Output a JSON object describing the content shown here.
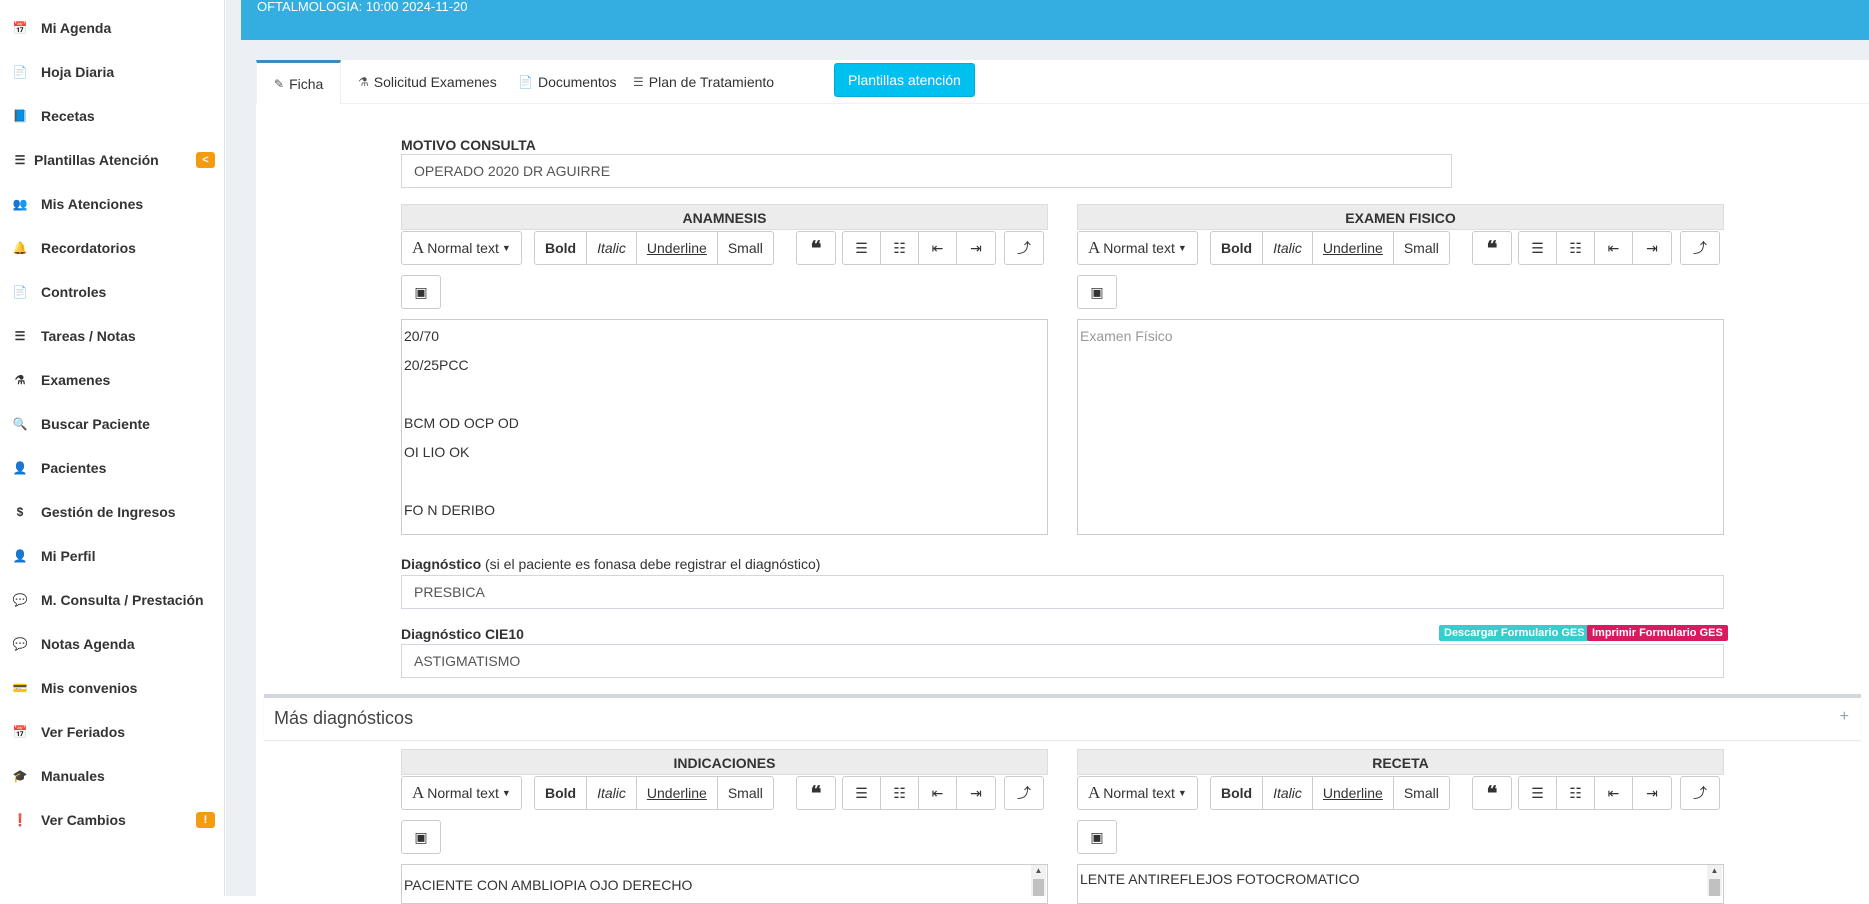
{
  "sidebar": {
    "items": [
      {
        "label": "Mi Agenda",
        "icon": "📅"
      },
      {
        "label": "Hoja Diaria",
        "icon": "📄"
      },
      {
        "label": "Recetas",
        "icon": "📘"
      },
      {
        "label": "Plantillas Atención",
        "icon": "☰",
        "badge": "<"
      },
      {
        "label": "Mis Atenciones",
        "icon": "👥"
      },
      {
        "label": "Recordatorios",
        "icon": "🔔"
      },
      {
        "label": "Controles",
        "icon": "📄"
      },
      {
        "label": "Tareas / Notas",
        "icon": "☰"
      },
      {
        "label": "Examenes",
        "icon": "⚗"
      },
      {
        "label": "Buscar Paciente",
        "icon": "🔍"
      },
      {
        "label": "Pacientes",
        "icon": "👤"
      },
      {
        "label": "Gestión de Ingresos",
        "icon": "$"
      },
      {
        "label": "Mi Perfil",
        "icon": "👤"
      },
      {
        "label": "M. Consulta / Prestación",
        "icon": "💬"
      },
      {
        "label": "Notas Agenda",
        "icon": "💬"
      },
      {
        "label": "Mis convenios",
        "icon": "💳"
      },
      {
        "label": "Ver Feriados",
        "icon": "📅"
      },
      {
        "label": "Manuales",
        "icon": "🎓"
      },
      {
        "label": "Ver Cambios",
        "icon": "❗",
        "badge": "!"
      }
    ]
  },
  "header": {
    "title": "OFTALMOLOGIA: 10:00 2024-11-20"
  },
  "tabs": [
    {
      "label": "Ficha",
      "icon": "✎"
    },
    {
      "label": "Solicitud Examenes",
      "icon": "⚗"
    },
    {
      "label": "Documentos",
      "icon": "📄"
    },
    {
      "label": "Plan de Tratamiento",
      "icon": "☰"
    }
  ],
  "plantillas_button": "Plantillas atención",
  "motivo": {
    "label": "MOTIVO CONSULTA",
    "value": "OPERADO 2020 DR AGUIRRE"
  },
  "toolbar": {
    "normal_text": "Normal text",
    "bold": "Bold",
    "italic": "Italic",
    "underline": "Underline",
    "small": "Small"
  },
  "anamnesis": {
    "title": "ANAMNESIS",
    "lines": [
      "20/70",
      "20/25PCC",
      "",
      "BCM OD OCP OD",
      "OI LIO OK",
      "",
      "FO N DERIBO"
    ]
  },
  "examen_fisico": {
    "title": "EXAMEN FISICO",
    "placeholder": "Examen Físico"
  },
  "diagnostico": {
    "label": "Diagnóstico",
    "sublabel": "(si el paciente es fonasa debe registrar el diagnóstico)",
    "value": "PRESBICA"
  },
  "cie10": {
    "label": "Diagnóstico CIE10",
    "value": "ASTIGMATISMO",
    "download_ges": "Descargar Formulario GES",
    "print_ges": "Imprimir Formulario GES"
  },
  "mas_diagnosticos": {
    "title": "Más diagnósticos",
    "toggle": "+"
  },
  "indicaciones": {
    "title": "INDICACIONES",
    "text": "PACIENTE CON AMBLIOPIA OJO DERECHO"
  },
  "receta": {
    "title": "RECETA",
    "text": "LENTE ANTIREFLEJOS FOTOCROMATICO"
  },
  "colors": {
    "header": "#34aee0",
    "tab_button": "#00c0ef",
    "badge": "#f39c12",
    "ges_download": "#39cccc",
    "ges_print": "#d81b60"
  }
}
